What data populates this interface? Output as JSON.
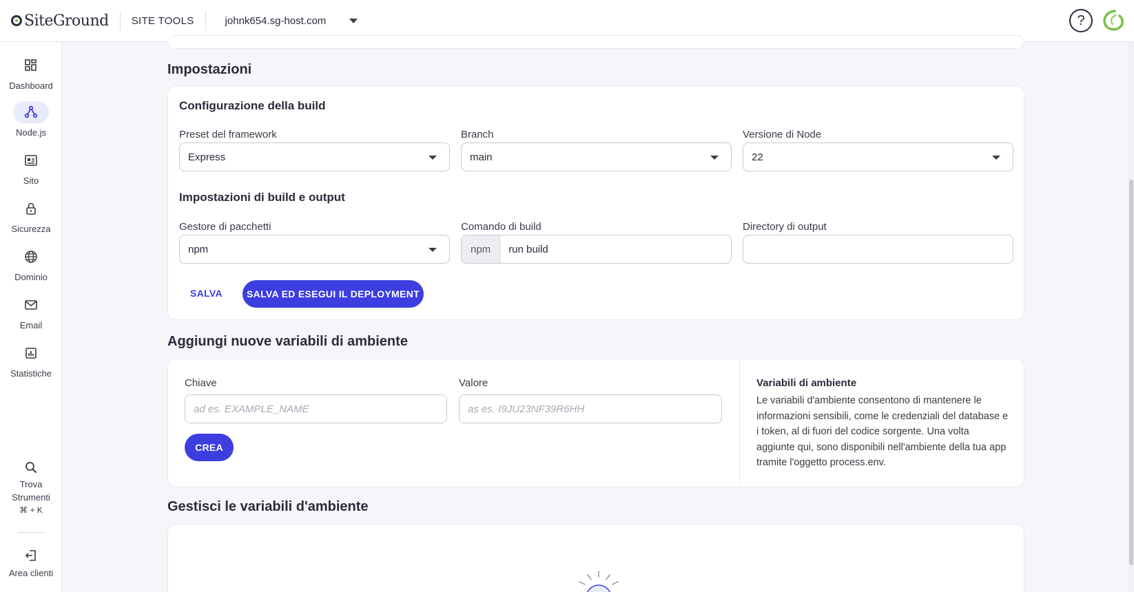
{
  "header": {
    "logo_text": "SiteGround",
    "site_tools": "SITE TOOLS",
    "domain": "johnk654.sg-host.com",
    "help_symbol": "?",
    "icons": [
      "help-icon",
      "siteground-swirl-icon",
      "chevron-down-icon"
    ]
  },
  "sidebar": {
    "items": [
      {
        "label": "Dashboard",
        "icon": "dashboard-grid-icon"
      },
      {
        "label": "Node.js",
        "icon": "nodejs-branch-icon",
        "active": true
      },
      {
        "label": "Sito",
        "icon": "site-window-icon"
      },
      {
        "label": "Sicurezza",
        "icon": "lock-icon"
      },
      {
        "label": "Dominio",
        "icon": "globe-icon"
      },
      {
        "label": "Email",
        "icon": "envelope-icon"
      },
      {
        "label": "Statistiche",
        "icon": "bar-chart-icon"
      }
    ],
    "find_tools": {
      "line1": "Trova",
      "line2": "Strumenti",
      "shortcut": "⌘ + K",
      "icon": "search-icon"
    },
    "client_area": {
      "label": "Area clienti",
      "icon": "logout-icon"
    }
  },
  "settings": {
    "section_title": "Impostazioni",
    "build_config_title": "Configurazione della build",
    "framework_preset": {
      "label": "Preset del framework",
      "value": "Express"
    },
    "branch": {
      "label": "Branch",
      "value": "main"
    },
    "node_version": {
      "label": "Versione di Node",
      "value": "22"
    },
    "build_output_title": "Impostazioni di build e output",
    "package_manager": {
      "label": "Gestore di pacchetti",
      "value": "npm"
    },
    "build_command": {
      "label": "Comando di build",
      "prefix": "npm",
      "value": "run build"
    },
    "output_directory": {
      "label": "Directory di output",
      "value": ""
    },
    "save_label": "SALVA",
    "save_deploy_label": "SALVA ED ESEGUI IL DEPLOYMENT"
  },
  "env_add": {
    "section_title": "Aggiungi nuove variabili di ambiente",
    "key": {
      "label": "Chiave",
      "placeholder": "ad es. EXAMPLE_NAME"
    },
    "value": {
      "label": "Valore",
      "placeholder": "as es. I9JU23NF39R6HH"
    },
    "create_label": "CREA",
    "info_title": "Variabili di ambiente",
    "info_text": "Le variabili d'ambiente consentono di mantenere le informazioni sensibili, come le credenziali del database e i token, al di fuori del codice sorgente. Una volta aggiunte qui, sono disponibili nell'ambiente della tua app tramite l'oggetto process.env."
  },
  "env_manage": {
    "section_title": "Gestisci le variabili d'ambiente",
    "illustration_icon": "empty-state-sun-icon"
  },
  "colors": {
    "accent": "#3c3ee0",
    "brand_green": "#7ac143",
    "active_nav_bg": "#e8eafd"
  }
}
